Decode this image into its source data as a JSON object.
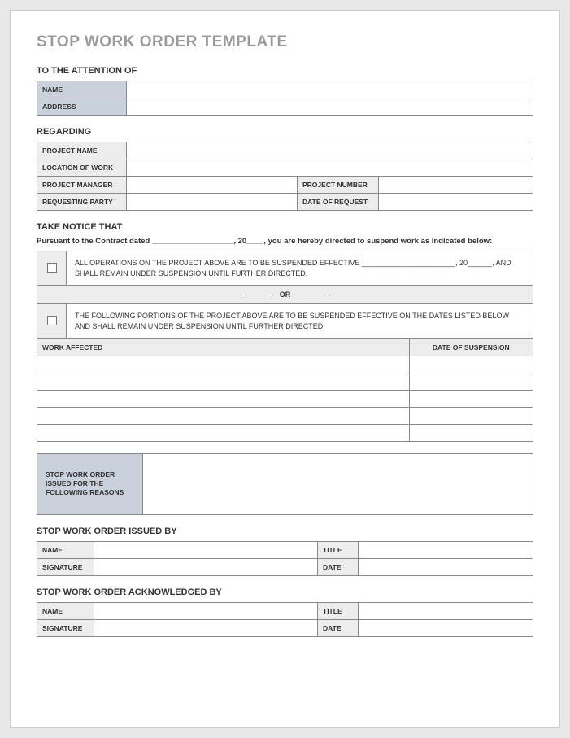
{
  "title": "STOP WORK ORDER TEMPLATE",
  "attention": {
    "heading": "TO THE ATTENTION OF",
    "name_label": "NAME",
    "address_label": "ADDRESS"
  },
  "regarding": {
    "heading": "REGARDING",
    "project_name_label": "PROJECT NAME",
    "location_label": "LOCATION OF WORK",
    "project_manager_label": "PROJECT MANAGER",
    "project_number_label": "PROJECT NUMBER",
    "requesting_party_label": "REQUESTING PARTY",
    "date_of_request_label": "DATE OF REQUEST"
  },
  "notice": {
    "heading": "TAKE NOTICE THAT",
    "pursuant": "Pursuant to the Contract dated ___________________, 20____, you are hereby directed to suspend work as indicated below:",
    "option1": "ALL OPERATIONS ON THE PROJECT ABOVE ARE TO BE SUSPENDED EFFECTIVE _______________________, 20______, AND SHALL REMAIN UNDER SUSPENSION UNTIL FURTHER DIRECTED.",
    "or": "OR",
    "option2": "THE FOLLOWING PORTIONS OF THE PROJECT ABOVE ARE TO BE SUSPENDED EFFECTIVE ON THE DATES LISTED BELOW AND SHALL REMAIN UNDER SUSPENSION UNTIL FURTHER DIRECTED.",
    "work_affected_label": "WORK AFFECTED",
    "date_suspension_label": "DATE OF SUSPENSION"
  },
  "reasons": {
    "label": "STOP WORK ORDER ISSUED FOR THE FOLLOWING REASONS"
  },
  "issued_by": {
    "heading": "STOP WORK ORDER ISSUED BY",
    "name_label": "NAME",
    "title_label": "TITLE",
    "signature_label": "SIGNATURE",
    "date_label": "DATE"
  },
  "ack_by": {
    "heading": "STOP WORK ORDER ACKNOWLEDGED BY",
    "name_label": "NAME",
    "title_label": "TITLE",
    "signature_label": "SIGNATURE",
    "date_label": "DATE"
  }
}
